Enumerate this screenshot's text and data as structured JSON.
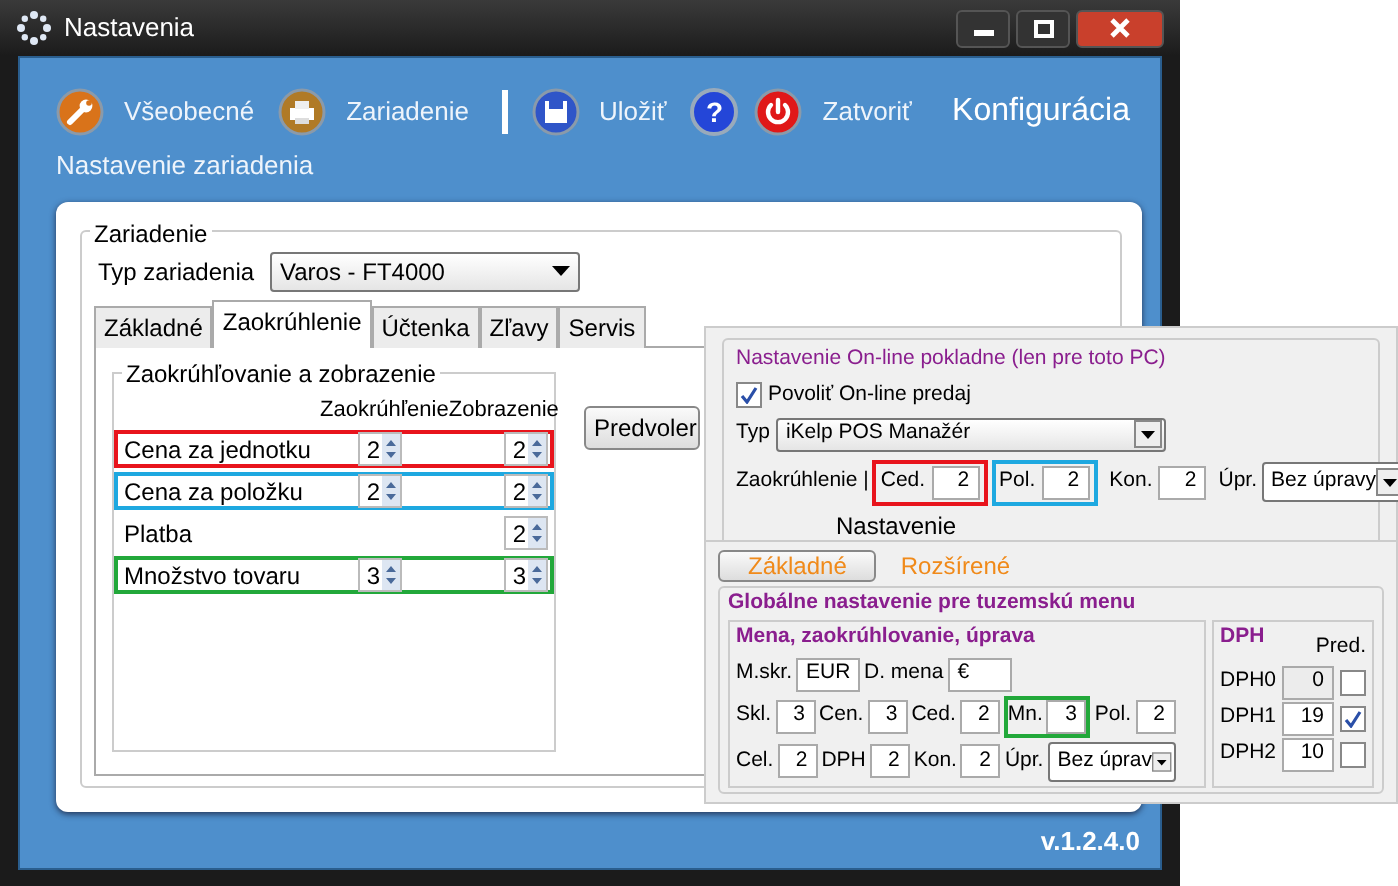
{
  "window": {
    "title": "Nastavenia"
  },
  "toolbar": [
    {
      "kind": "wrench",
      "label": "Všeobecné"
    },
    {
      "kind": "printer",
      "label": "Zariadenie"
    },
    {
      "kind": "separator"
    },
    {
      "kind": "save",
      "label": "Uložiť"
    },
    {
      "kind": "help",
      "glyph": "?"
    },
    {
      "kind": "power",
      "label": "Zatvoriť"
    }
  ],
  "header_title": "Konfigurácia",
  "subtitle": "Nastavenie zariadenia",
  "device": {
    "group_title": "Zariadenie",
    "type_label": "Typ zariadenia",
    "type_value": "Varos - FT4000",
    "tabs": [
      {
        "label": "Základné",
        "selected": false
      },
      {
        "label": "Zaokrúhlenie",
        "selected": true
      },
      {
        "label": "Účtenka",
        "selected": false
      },
      {
        "label": "Zľavy",
        "selected": false
      },
      {
        "label": "Servis",
        "selected": false
      }
    ],
    "rounding": {
      "group_title": "Zaokrúhľovanie a zobrazenie",
      "columns": [
        "Zaokrúhľenie",
        "Zobrazenie"
      ],
      "rows": [
        {
          "label": "Cena za jednotku",
          "rounding": "2",
          "display": "2",
          "color": "#e8141c"
        },
        {
          "label": "Cena za položku",
          "rounding": "2",
          "display": "2",
          "color": "#1ea8e0"
        },
        {
          "label": "Platba",
          "display": "2"
        },
        {
          "label": "Množstvo tovaru",
          "rounding": "3",
          "display": "3",
          "color": "#22a83a"
        }
      ]
    },
    "preset_button": "Predvoler"
  },
  "online": {
    "title": "Nastavenie On-line pokladne (len pre toto PC)",
    "enable": {
      "label": "Povoliť On-line predaj",
      "checked": true
    },
    "type_label": "Typ",
    "type_value": "iKelp POS Manažér",
    "rounding_label": "Zaokrúhlenie |",
    "fields": [
      {
        "label": "Ced.",
        "value": "2",
        "color": "#e8141c"
      },
      {
        "label": "Pol.",
        "value": "2",
        "color": "#1ea8e0"
      },
      {
        "label": "Kon.",
        "value": "2"
      }
    ],
    "adjust_label": "Úpr.",
    "adjust_value": "Bez úpravy",
    "settings_label": "Nastavenie"
  },
  "global": {
    "tabs": [
      {
        "label": "Základné",
        "selected": true
      },
      {
        "label": "Rozšírené",
        "selected": false
      }
    ],
    "title": "Globálne nastavenie pre tuzemskú menu",
    "currency": {
      "title": "Mena, zaokrúhlovanie, úprava",
      "rows": [
        [
          {
            "label": "M.skr.",
            "value": "EUR",
            "kind": "text"
          },
          {
            "label": "D. mena",
            "value": "€",
            "kind": "text"
          }
        ],
        [
          {
            "label": "Skl.",
            "value": "3",
            "kind": "number"
          },
          {
            "label": "Cen.",
            "value": "3",
            "kind": "number"
          },
          {
            "label": "Ced.",
            "value": "2",
            "kind": "number"
          },
          {
            "label": "Mn.",
            "value": "3",
            "kind": "number",
            "color": "#22a83a"
          },
          {
            "label": "Pol.",
            "value": "2",
            "kind": "number"
          }
        ],
        [
          {
            "label": "Cel.",
            "value": "2",
            "kind": "number"
          },
          {
            "label": "DPH",
            "value": "2",
            "kind": "number"
          },
          {
            "label": "Kon.",
            "value": "2",
            "kind": "number"
          },
          {
            "label": "Úpr.",
            "value": "Bez úprav",
            "kind": "select"
          }
        ]
      ]
    },
    "vat": {
      "title": "DPH",
      "column": "Pred.",
      "rows": [
        {
          "label": "DPH0",
          "value": "0",
          "checked": false,
          "disabled": true
        },
        {
          "label": "DPH1",
          "value": "19",
          "checked": true,
          "disabled": false
        },
        {
          "label": "DPH2",
          "value": "10",
          "checked": false,
          "disabled": false
        }
      ]
    }
  },
  "version": "v.1.2.4.0"
}
